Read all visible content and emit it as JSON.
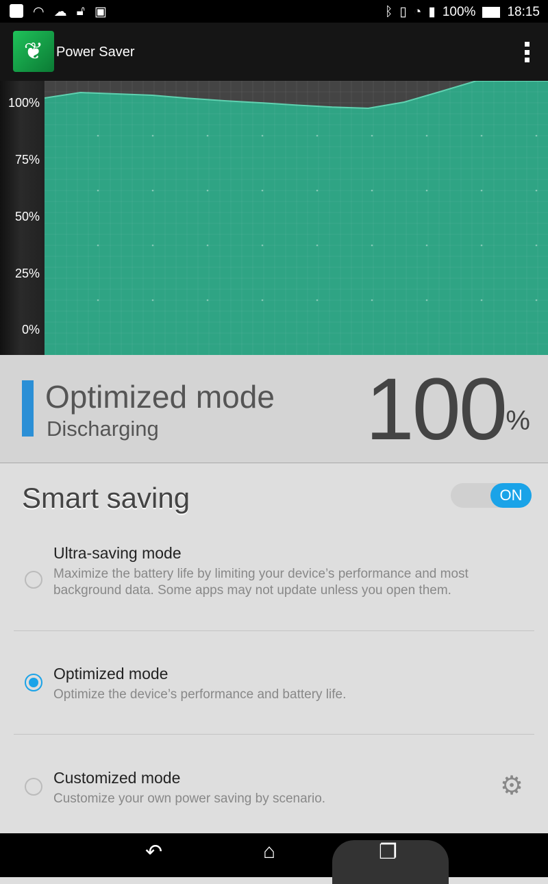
{
  "status_bar": {
    "battery": "100%",
    "time": "18:15"
  },
  "app": {
    "title": "Power Saver"
  },
  "chart": {
    "y_labels": [
      "100%",
      "75%",
      "50%",
      "25%",
      "0%"
    ],
    "fill_color": "#2fa484",
    "chart_data": {
      "type": "area",
      "ylabel": "",
      "yticks": [
        "100%",
        "75%",
        "50%",
        "25%",
        "0%"
      ],
      "ylim": [
        0,
        109.3
      ],
      "grid": true,
      "values": [
        101.8,
        104.2,
        103.6,
        103.0,
        101.7,
        100.6,
        99.7,
        98.7,
        97.8,
        97.3,
        100.0,
        104.6,
        109.3,
        109.3,
        109.3
      ]
    }
  },
  "battery_status": {
    "mode": "Optimized mode",
    "state": "Discharging",
    "level": "100",
    "unit": "%",
    "accent": "#2b8fd6"
  },
  "smart_saving": {
    "title": "Smart saving",
    "toggle": "ON",
    "options": [
      {
        "title": "Ultra-saving mode",
        "desc": "Maximize the battery life by limiting your device’s performance and most background data. Some apps may not update unless you open them.",
        "selected": false
      },
      {
        "title": "Optimized mode",
        "desc": "Optimize the device’s performance and battery life.",
        "selected": true
      },
      {
        "title": "Customized mode",
        "desc": "Customize your own power saving by scenario.",
        "selected": false
      }
    ]
  }
}
